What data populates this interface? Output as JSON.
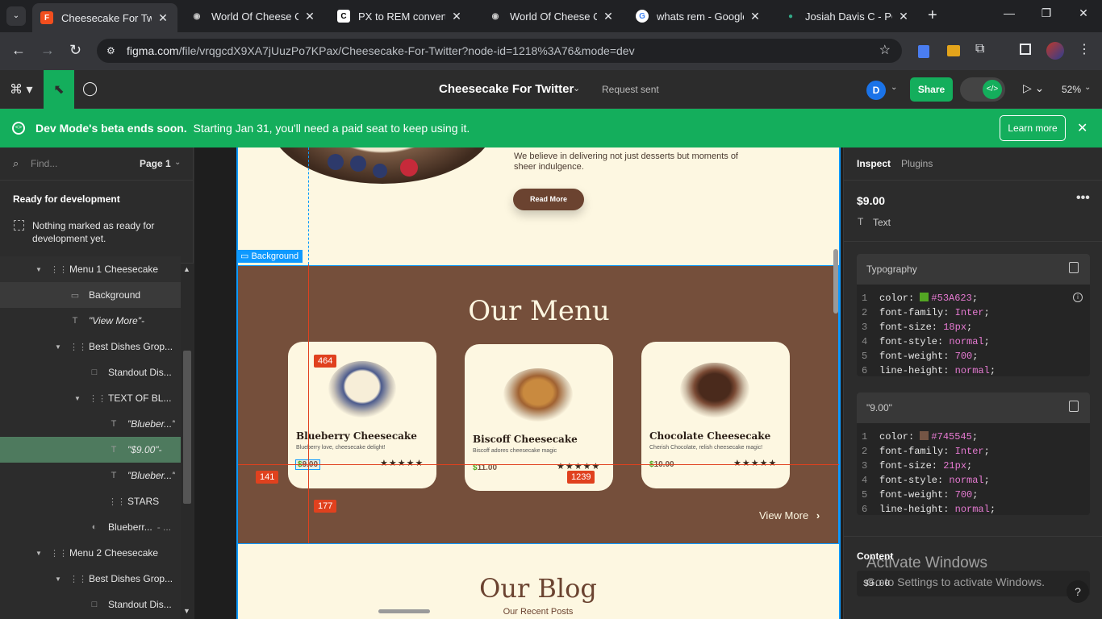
{
  "browser": {
    "tabs": [
      {
        "title": "Cheesecake For Twitte",
        "active": true
      },
      {
        "title": "World Of Cheese Cak"
      },
      {
        "title": "PX to REM converter"
      },
      {
        "title": "World Of Cheese Cak"
      },
      {
        "title": "whats rem - Google S"
      },
      {
        "title": "Josiah Davis C - POR"
      }
    ],
    "url_domain": "figma.com",
    "url_path": "/file/vrqgcdX9XA7jUuzPo7KPax/Cheesecake-For-Twitter?node-id=1218%3A76&mode=dev"
  },
  "toolbar": {
    "file_name": "Cheesecake For Twitter",
    "request_status": "Request sent",
    "avatar_initial": "D",
    "share_label": "Share",
    "zoom": "52%"
  },
  "banner": {
    "bold": "Dev Mode's beta ends soon.",
    "text": "Starting Jan 31, you'll need a paid seat to keep using it.",
    "button": "Learn more"
  },
  "left_panel": {
    "search_placeholder": "Find...",
    "page": "Page 1",
    "ready_title": "Ready for development",
    "ready_empty": "Nothing marked as ready for development yet.",
    "layers": [
      {
        "name": "Menu 1 Cheesecake"
      },
      {
        "name": "Background"
      },
      {
        "name": "\"View More\"-"
      },
      {
        "name": "Best Dishes Grop..."
      },
      {
        "name": "Standout Dis..."
      },
      {
        "name": "TEXT OF BL..."
      },
      {
        "name": "\"Blueber...\""
      },
      {
        "name": "\"$9.00\"-"
      },
      {
        "name": "\"Blueber...\""
      },
      {
        "name": "STARS"
      },
      {
        "name": "Blueberr...",
        "suffix": "- ..."
      },
      {
        "name": "Menu 2 Cheesecake"
      },
      {
        "name": "Best Dishes Grop..."
      },
      {
        "name": "Standout Dis..."
      }
    ]
  },
  "canvas": {
    "intro_text": "We believe in delivering not just desserts but moments of sheer indulgence.",
    "read_more": "Read More",
    "selection_label": "Background",
    "menu_title": "Our Menu",
    "cards": [
      {
        "name": "Blueberry Cheesecake",
        "desc": "Blueberry love, cheesecake delight!",
        "price_sign": "$",
        "price": "9.00",
        "stars": "★★★★★"
      },
      {
        "name": "Biscoff Cheesecake",
        "desc": "Biscoff adores cheesecake magic",
        "price_sign": "$",
        "price": "11.00",
        "stars": "★★★★★"
      },
      {
        "name": "Chocolate Cheesecake",
        "desc": "Cherish Chocolate, relish cheesecake magic!",
        "price_sign": "$",
        "price": "10.00",
        "stars": "★★★★★"
      }
    ],
    "view_more": "View More",
    "measure": {
      "top": "464",
      "left": "141",
      "bottom": "177",
      "right": "1239"
    },
    "blog_title": "Our Blog",
    "blog_sub": "Our Recent Posts"
  },
  "right_panel": {
    "tabs": [
      "Inspect",
      "Plugins"
    ],
    "selected_name": "$9.00",
    "selected_type": "Text",
    "typography_title": "Typography",
    "typography_code": [
      {
        "k": "color: ",
        "v": "#53A623",
        "swatch": "#53A623"
      },
      {
        "k": "font-family: ",
        "v": "Inter"
      },
      {
        "k": "font-size: ",
        "v": "18px"
      },
      {
        "k": "font-style: ",
        "v": "normal"
      },
      {
        "k": "font-weight: ",
        "v": "700"
      },
      {
        "k": "line-height: ",
        "v": "normal"
      }
    ],
    "segment_title": "\"9.00\"",
    "segment_code": [
      {
        "k": "color: ",
        "v": "#745545",
        "swatch": "#745545"
      },
      {
        "k": "font-family: ",
        "v": "Inter"
      },
      {
        "k": "font-size: ",
        "v": "21px"
      },
      {
        "k": "font-style: ",
        "v": "normal"
      },
      {
        "k": "font-weight: ",
        "v": "700"
      },
      {
        "k": "line-height: ",
        "v": "normal"
      }
    ],
    "content_title": "Content",
    "content_value": "$9.00"
  },
  "windows": {
    "activate_title": "Activate Windows",
    "activate_sub": "Go to Settings to activate Windows."
  },
  "colors": {
    "figma_green": "#14ae5c",
    "menu_bg": "#754f3b",
    "cream": "#fdf7e1",
    "accent_red": "#e0411e",
    "selection_blue": "#0d99ff",
    "price_green": "#53A623",
    "brown": "#745545"
  }
}
